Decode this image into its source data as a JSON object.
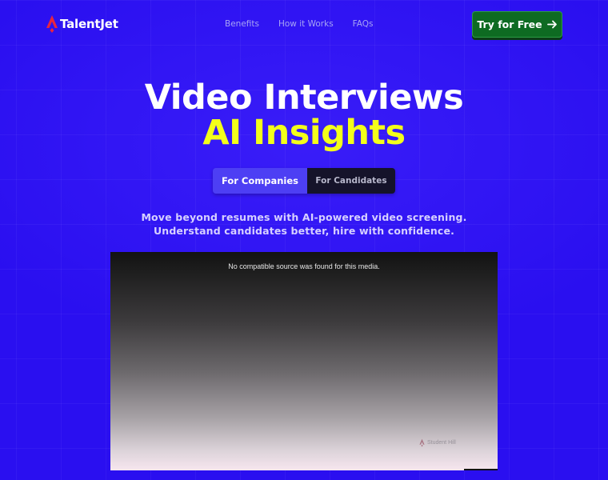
{
  "brand": {
    "name": "TalentJet",
    "accent_color": "#e8253f",
    "logo_icon": "talentjet-logo-icon"
  },
  "nav": {
    "items": [
      {
        "label": "Benefits"
      },
      {
        "label": "How it Works"
      },
      {
        "label": "FAQs"
      }
    ]
  },
  "cta": {
    "label": "Try for Free",
    "icon": "arrow-right-icon",
    "color": "#0e6b22"
  },
  "hero": {
    "title_line1": "Video Interviews",
    "title_line2": "AI Insights",
    "title_line2_color": "#f3ff1a",
    "background_color": "#2a0ff0"
  },
  "audience_toggle": {
    "options": [
      {
        "label": "For Companies",
        "selected": true
      },
      {
        "label": "For Candidates",
        "selected": false
      }
    ]
  },
  "subtitle": {
    "line1": "Move beyond resumes with AI-powered video screening.",
    "line2": "Understand candidates better, hire with confidence."
  },
  "video": {
    "error_message": "No compatible source was found for this media.",
    "watermark_text": "Student Hill"
  }
}
